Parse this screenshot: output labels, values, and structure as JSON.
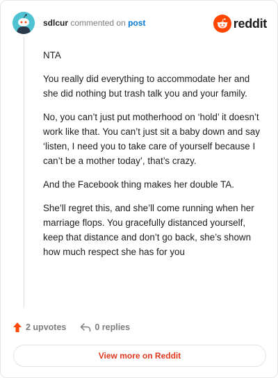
{
  "comment": {
    "author": "sdlcur",
    "meta_text": "commented on",
    "link_text": "post",
    "paragraphs": [
      "NTA",
      "You really did everything to accommodate her and she did nothing but trash talk you and your family.",
      "No, you can’t just put motherhood on ‘hold’ it doesn’t work like that. You can’t just sit a baby down and say ‘listen, I need you to take care of yourself because I can’t be a mother today’, that’s crazy.",
      "And the Facebook thing makes her double TA.",
      "She’ll regret this, and she’ll come running when her marriage flops. You gracefully distanced yourself, keep that distance and don’t go back, she’s shown how much respect she has for you"
    ]
  },
  "brand": {
    "name": "reddit",
    "logo_icon": "reddit-alien-icon",
    "color": "#ff4500"
  },
  "actions": {
    "upvotes": "2 upvotes",
    "replies": "0 replies",
    "upvote_icon": "upvote-arrow-icon",
    "reply_icon": "reply-arrow-icon"
  },
  "footer": {
    "view_more": "View more on Reddit"
  },
  "colors": {
    "accent": "#e0381d",
    "link": "#0079d3",
    "upvote": "#ff4500",
    "avatar": "#4fc3d1"
  }
}
